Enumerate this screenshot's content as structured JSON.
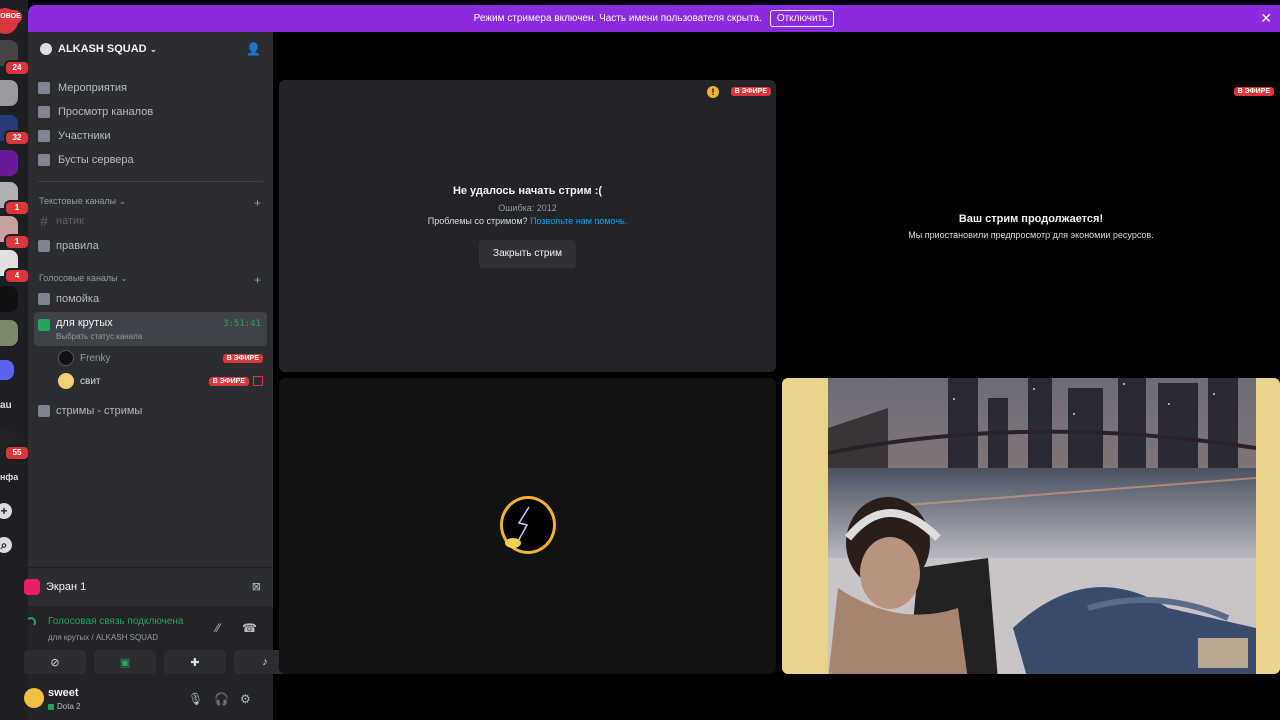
{
  "rail": {
    "new_badge": "НОВОЕ",
    "badges": [
      "24",
      "32",
      "1",
      "1",
      "4",
      "55"
    ],
    "labels": [
      "au",
      "нфа"
    ]
  },
  "banner": {
    "text": "Режим стримера включен. Часть имени пользователя скрыта.",
    "button": "Отключить"
  },
  "guild": {
    "name": "ALKASH SQUAD",
    "nav": [
      "Мероприятия",
      "Просмотр каналов",
      "Участники",
      "Бусты сервера"
    ],
    "text_category": "Текстовые каналы",
    "text_channels": [
      "натик",
      "правила"
    ],
    "voice_category": "Голосовые каналы",
    "voice_channels": [
      "помойка",
      "для крутых",
      "стримы - стримы"
    ],
    "active_channel": {
      "name": "для крутых",
      "timer": "3:51:41",
      "status": "Выбрать статус канала"
    },
    "members": [
      {
        "name": "Frenky",
        "badge": "В ЭФИРЕ"
      },
      {
        "name": "свит",
        "badge": "В ЭФИРЕ"
      }
    ]
  },
  "screen_share": {
    "label": "Экран 1"
  },
  "voice": {
    "status": "Голосовая связь подключена",
    "location": "для крутых / ALKASH SQUAD"
  },
  "user": {
    "name": "sweet",
    "activity": "Dota 2"
  },
  "tiles": {
    "error": {
      "badge": "В ЭФИРЕ",
      "title": "Не удалось начать стрим :(",
      "code": "Ошибка: 2012",
      "help_prefix": "Проблемы со стримом?",
      "help_link": "Позвольте нам помочь.",
      "close_button": "Закрыть стрим"
    },
    "paused": {
      "badge": "В ЭФИРЕ",
      "title": "Ваш стрим продолжается!",
      "subtitle": "Мы приостановили предпросмотр для экономии ресурсов."
    }
  },
  "colors": {
    "banner": "#8a2be2",
    "live": "#da373c",
    "voice_green": "#23a55a",
    "link": "#00a8fc"
  }
}
